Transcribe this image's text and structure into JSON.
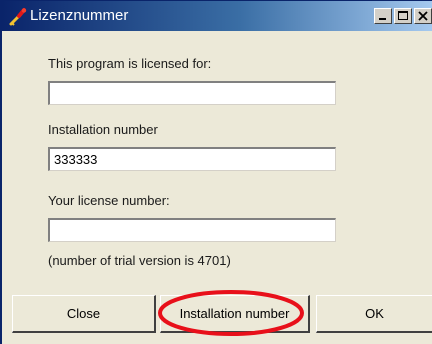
{
  "window": {
    "title": "Lizenznummer",
    "icon": "key-icon",
    "controls": {
      "minimize": "minimize-icon",
      "maximize": "maximize-icon",
      "close": "close-icon"
    }
  },
  "form": {
    "licensed_for_label": "This program is licensed for:",
    "licensed_for_value": "",
    "installation_label": "Installation number",
    "installation_value": "333333",
    "license_label": "Your license number:",
    "license_value": "",
    "trial_note": "(number of trial version is 4701)"
  },
  "buttons": {
    "close": "Close",
    "installation_number": "Installation number",
    "ok": "OK"
  },
  "colors": {
    "titlebar_start": "#0A246A",
    "titlebar_end": "#A6CAF0",
    "dialog_bg": "#ECE9D8",
    "highlight": "#E8101A"
  }
}
